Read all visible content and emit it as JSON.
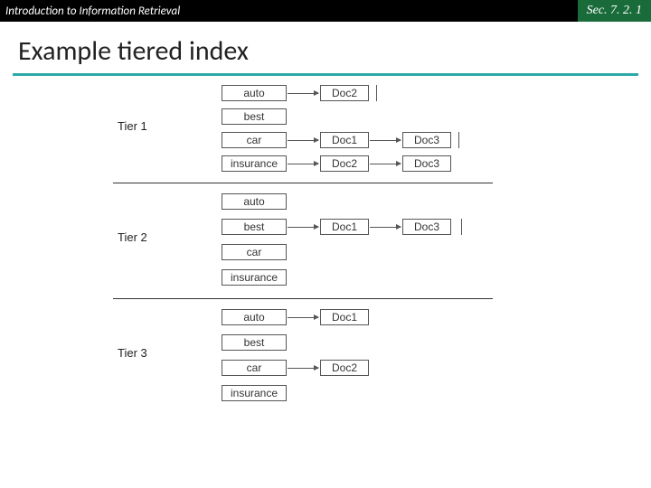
{
  "header": {
    "left": "Introduction to Information Retrieval",
    "right": "Sec. 7. 2. 1"
  },
  "title": "Example tiered index",
  "tiers": {
    "t1": {
      "label": "Tier 1"
    },
    "t2": {
      "label": "Tier 2"
    },
    "t3": {
      "label": "Tier 3"
    }
  },
  "terms": {
    "auto": "auto",
    "best": "best",
    "car": "car",
    "insurance": "insurance"
  },
  "docs": {
    "d1": "Doc1",
    "d2": "Doc2",
    "d3": "Doc3"
  }
}
